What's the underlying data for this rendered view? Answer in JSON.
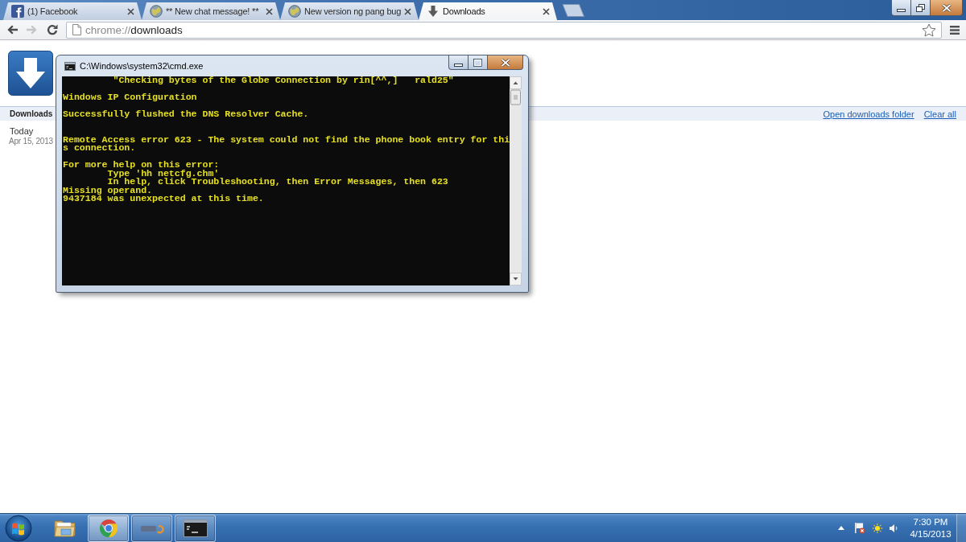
{
  "browser": {
    "tabs": [
      {
        "title": "(1) Facebook",
        "kind": "social",
        "selected": false
      },
      {
        "title": "** New chat message! **",
        "kind": "globe",
        "selected": false
      },
      {
        "title": "New version ng pang bug",
        "kind": "globe",
        "selected": false
      },
      {
        "title": "Downloads",
        "kind": "downloads",
        "selected": true
      }
    ],
    "nav_buttons": [
      {
        "kind": "back",
        "disabled": false
      },
      {
        "kind": "forward",
        "disabled": true
      },
      {
        "kind": "reload",
        "disabled": false
      }
    ],
    "address": {
      "scheme": "chrome://",
      "path": "downloads"
    }
  },
  "downloads_page": {
    "heading": "Downloads",
    "links": [
      "Open downloads folder",
      "Clear all"
    ],
    "groups": [
      {
        "label": "Today",
        "date": "Apr 15, 2013"
      }
    ]
  },
  "console_window": {
    "title": "C:\\Windows\\system32\\cmd.exe",
    "output": "         \"Checking bytes of the Globe Connection by rin[^^,]   rald25\"\n\nWindows IP Configuration\n\nSuccessfully flushed the DNS Resolver Cache.\n\n\nRemote Access error 623 - The system could not find the phone book entry for thi\ns connection.\n\nFor more help on this error:\n        Type 'hh netcfg.chm'\n        In help, click Troubleshooting, then Error Messages, then 623\nMissing operand.\n9437184 was unexpected at this time."
  },
  "taskbar": {
    "apps": [
      {
        "kind": "folder",
        "running": false,
        "selected": false
      },
      {
        "kind": "browser",
        "running": true,
        "selected": true
      },
      {
        "kind": "app",
        "running": true,
        "selected": false
      },
      {
        "kind": "console",
        "running": true,
        "selected": false
      }
    ],
    "clock": {
      "time": "7:30 PM",
      "date": "4/15/2013"
    }
  }
}
